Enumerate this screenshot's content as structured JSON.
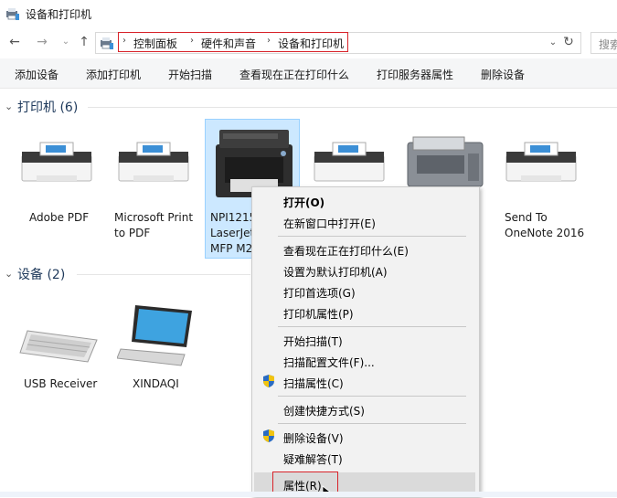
{
  "window": {
    "title": "设备和打印机"
  },
  "address": {
    "crumbs": [
      "控制面板",
      "硬件和声音",
      "设备和打印机"
    ],
    "search_placeholder": "搜索"
  },
  "toolbar": {
    "items": [
      "添加设备",
      "添加打印机",
      "开始扫描",
      "查看现在正在打印什么",
      "打印服务器属性",
      "删除设备"
    ]
  },
  "printers": {
    "header": "打印机 (6)",
    "items": [
      {
        "line1": "Adobe PDF",
        "line2": ""
      },
      {
        "line1": "Microsoft Print",
        "line2": "to PDF"
      },
      {
        "line1": "NPI1215",
        "line2": "LaserJet",
        "line3": "MFP M2"
      },
      {
        "line1": "",
        "line2": ""
      },
      {
        "line1": "",
        "line2": ""
      },
      {
        "line1": "Send To",
        "line2": "OneNote 2016"
      }
    ]
  },
  "devices": {
    "header": "设备 (2)",
    "items": [
      {
        "label": "USB Receiver"
      },
      {
        "label": "XINDAQI"
      }
    ]
  },
  "context_menu": {
    "items": [
      "打开(O)",
      "在新窗口中打开(E)",
      "查看现在正在打印什么(E)",
      "设置为默认打印机(A)",
      "打印首选项(G)",
      "打印机属性(P)",
      "开始扫描(T)",
      "扫描配置文件(F)...",
      "扫描属性(C)",
      "创建快捷方式(S)",
      "删除设备(V)",
      "疑难解答(T)",
      "属性(R)"
    ]
  },
  "colors": {
    "selection": "#cce8ff",
    "highlight_box": "#d8232a",
    "menu_bg": "#f2f2f2"
  }
}
